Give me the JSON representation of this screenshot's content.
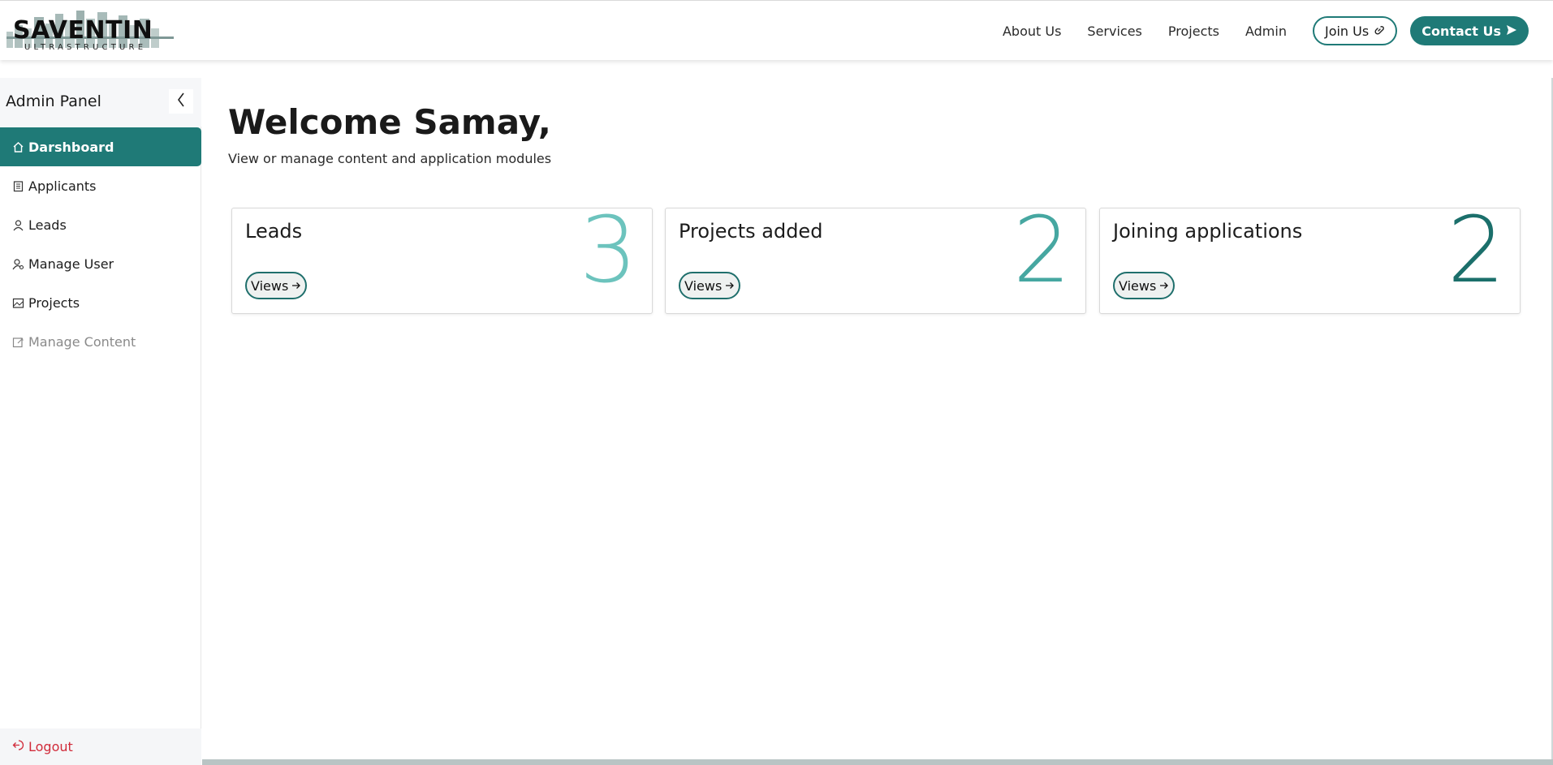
{
  "header": {
    "logo_word": "SAVENTIN",
    "logo_sub": "ULTRASTRUCTURE",
    "nav": [
      "About Us",
      "Services",
      "Projects",
      "Admin"
    ],
    "join_label": "Join Us",
    "contact_label": "Contact Us"
  },
  "sidebar": {
    "title": "Admin Panel",
    "items": [
      {
        "label": "Darshboard",
        "icon": "home-icon"
      },
      {
        "label": "Applicants",
        "icon": "clipboard-icon"
      },
      {
        "label": "Leads",
        "icon": "user-icon"
      },
      {
        "label": "Manage User",
        "icon": "user-gear-icon"
      },
      {
        "label": "Projects",
        "icon": "image-icon"
      },
      {
        "label": "Manage Content",
        "icon": "edit-icon"
      }
    ],
    "logout_label": "Logout"
  },
  "main": {
    "welcome_prefix": "Welcome ",
    "user_name": "Samay",
    "welcome_suffix": ",",
    "subtitle": "View or manage content and application modules",
    "cards": [
      {
        "title": "Leads",
        "count": "3",
        "color": "#6cc3bd",
        "button": "Views"
      },
      {
        "title": "Projects added",
        "count": "2",
        "color": "#46a7a1",
        "button": "Views"
      },
      {
        "title": "Joining applications",
        "count": "2",
        "color": "#1b6f6b",
        "button": "Views"
      }
    ]
  },
  "colors": {
    "brand": "#1f7a77",
    "logout": "#d12b3a"
  }
}
